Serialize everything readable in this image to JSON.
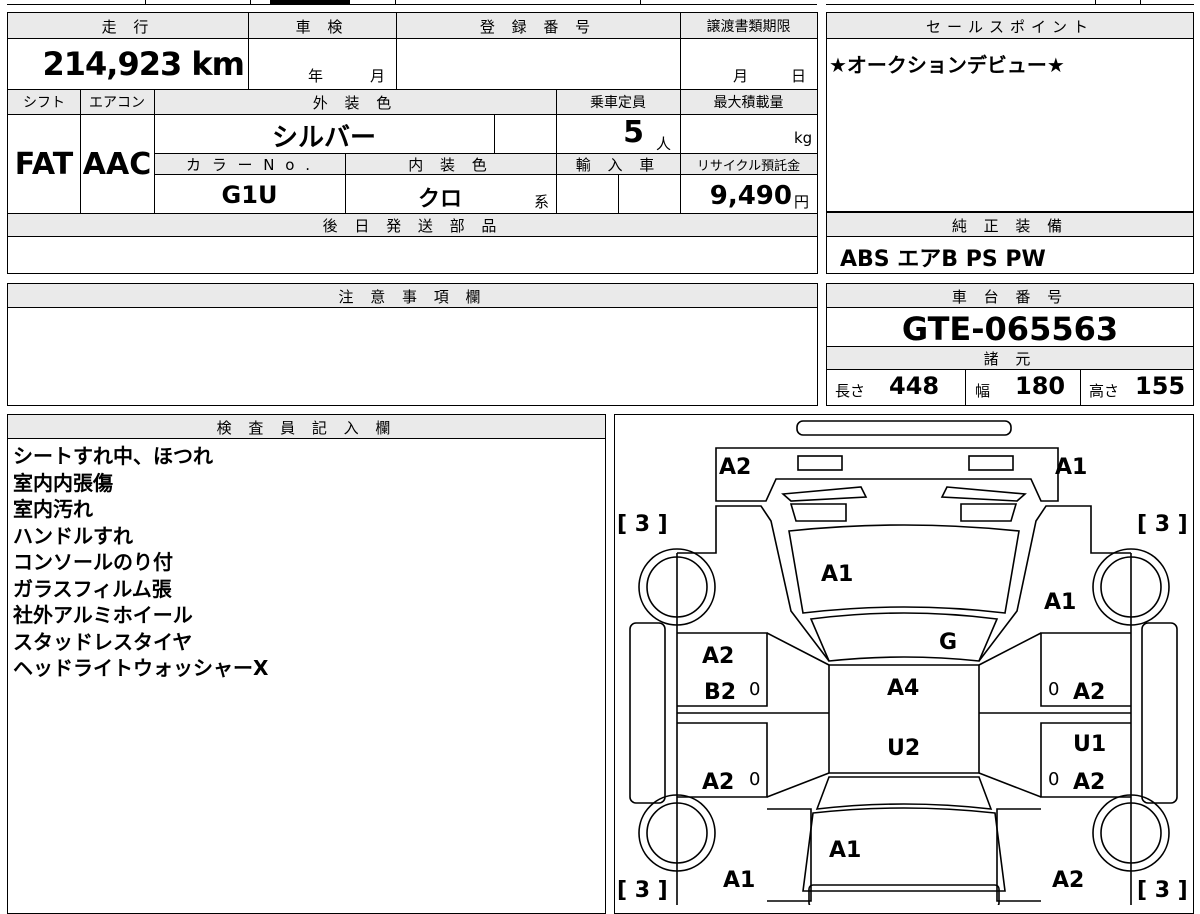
{
  "vehicle": {
    "mileage_header": "走 行",
    "mileage_value": "214,923 km",
    "inspection_header": "車 検",
    "inspection_year_unit": "年",
    "inspection_month_unit": "月",
    "registration_header": "登 録 番 号",
    "transfer_header": "譲渡書類期限",
    "transfer_month_unit": "月",
    "transfer_day_unit": "日",
    "shift_header": "シフト",
    "shift_value": "FAT",
    "ac_header": "エアコン",
    "ac_value": "AAC",
    "exterior_header": "外 装 色",
    "exterior_value": "シルバー",
    "capacity_header": "乗車定員",
    "capacity_value": "5",
    "capacity_unit": "人",
    "maxload_header": "最大積載量",
    "maxload_unit": "kg",
    "color_no_header": "カ ラ ー N o .",
    "color_no_value": "G1U",
    "interior_header": "内 装 色",
    "interior_value": "クロ",
    "interior_unit": "系",
    "import_header": "輸 入 車",
    "recycle_header": "リサイクル預託金",
    "recycle_value": "9,490",
    "recycle_unit": "円",
    "later_parts_header": "後 日 発 送 部 品"
  },
  "sales": {
    "header": "セールスポイント",
    "value": "★オークションデビュー★"
  },
  "equipment": {
    "header": "純 正 装 備",
    "value": "ABS エアB PS PW"
  },
  "notes": {
    "header": "注 意 事 項 欄"
  },
  "chassis": {
    "header": "車 台 番 号",
    "value": "GTE-065563"
  },
  "specs": {
    "header": "諸 元",
    "length_label": "長さ",
    "length_value": "448",
    "width_label": "幅",
    "width_value": "180",
    "height_label": "高さ",
    "height_value": "155"
  },
  "inspector": {
    "header": "検 査 員 記 入 欄",
    "lines": [
      "シートすれ中、ほつれ",
      "室内内張傷",
      "室内汚れ",
      "ハンドルすれ",
      "コンソールのり付",
      "ガラスフィルム張",
      "社外アルミホイール",
      "スタッドレスタイヤ",
      "ヘッドライトウォッシャーX"
    ]
  },
  "diagram": {
    "front_left": "A2",
    "front_right": "A1",
    "bracket_tl": "[ 3 ]",
    "bracket_tr": "[ 3 ]",
    "bracket_bl": "[ 3 ]",
    "bracket_br": "[ 3 ]",
    "hood": "A1",
    "right_front_fender": "A1",
    "windshield": "G",
    "left_front_door_a": "A2",
    "left_front_door_b": "B2",
    "left_front_zero": "0",
    "roof": "A4",
    "right_front_zero": "0",
    "right_front_door": "A2",
    "roof_rear": "U2",
    "right_rear_u": "U1",
    "left_rear_door": "A2",
    "left_rear_zero": "0",
    "right_rear_zero": "0",
    "right_rear_door": "A2",
    "trunk": "A1",
    "left_rear_fender": "A1",
    "right_rear_fender": "A2"
  }
}
